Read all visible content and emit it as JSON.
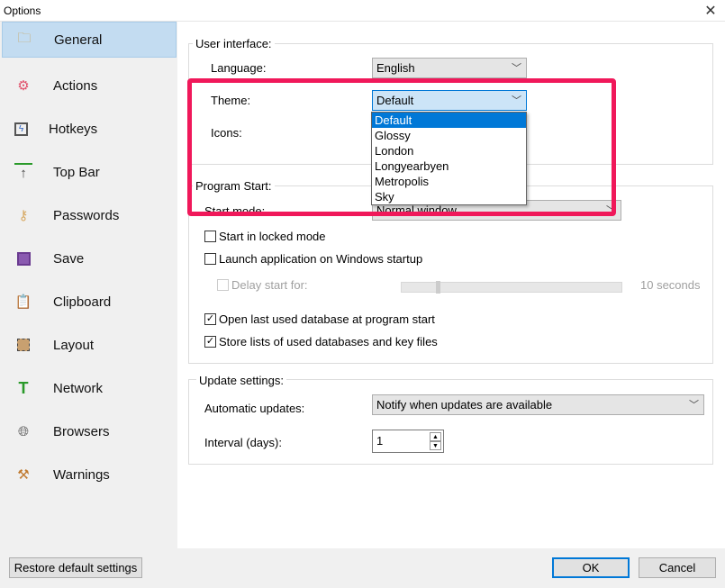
{
  "window": {
    "title": "Options",
    "close_icon": "close-icon"
  },
  "sidebar": {
    "items": [
      {
        "label": "General",
        "icon": "folder-tools-icon",
        "selected": true
      },
      {
        "label": "Actions",
        "icon": "gear-icon"
      },
      {
        "label": "Hotkeys",
        "icon": "lightning-icon"
      },
      {
        "label": "Top Bar",
        "icon": "arrow-up-bar-icon"
      },
      {
        "label": "Passwords",
        "icon": "key-icon"
      },
      {
        "label": "Save",
        "icon": "floppy-disk-icon"
      },
      {
        "label": "Clipboard",
        "icon": "clipboard-icon"
      },
      {
        "label": "Layout",
        "icon": "layout-icon"
      },
      {
        "label": "Network",
        "icon": "network-icon"
      },
      {
        "label": "Browsers",
        "icon": "globe-icon"
      },
      {
        "label": "Warnings",
        "icon": "gavel-icon"
      }
    ]
  },
  "user_interface": {
    "title": "User interface:",
    "language_label": "Language:",
    "language_value": "English",
    "theme_label": "Theme:",
    "theme_value": "Default",
    "icons_label": "Icons:",
    "theme_options": [
      "Default",
      "Glossy",
      "London",
      "Longyearbyen",
      "Metropolis",
      "Sky"
    ],
    "theme_selected_index": 0
  },
  "program_start": {
    "title": "Program Start:",
    "start_mode_label": "Start mode:",
    "start_mode_value": "Normal window",
    "locked_mode": {
      "label": "Start in locked mode",
      "checked": false
    },
    "launch_startup": {
      "label": "Launch application on Windows startup",
      "checked": false
    },
    "delay_start": {
      "label": "Delay start for:",
      "checked": false,
      "enabled": false,
      "value_text": "10 seconds",
      "slider_fraction": 0.07
    },
    "open_last": {
      "label": "Open last used database at program start",
      "checked": true
    },
    "store_lists": {
      "label": "Store lists of used databases and key files",
      "checked": true
    }
  },
  "update_settings": {
    "title": "Update settings:",
    "auto_label": "Automatic updates:",
    "auto_value": "Notify when updates are available",
    "interval_label": "Interval (days):",
    "interval_value": "1"
  },
  "footer": {
    "restore": "Restore default settings",
    "ok": "OK",
    "cancel": "Cancel"
  },
  "colors": {
    "highlight": "#f0185a",
    "selection": "#0078d7",
    "sidebar_selected": "#c3dcf1"
  }
}
